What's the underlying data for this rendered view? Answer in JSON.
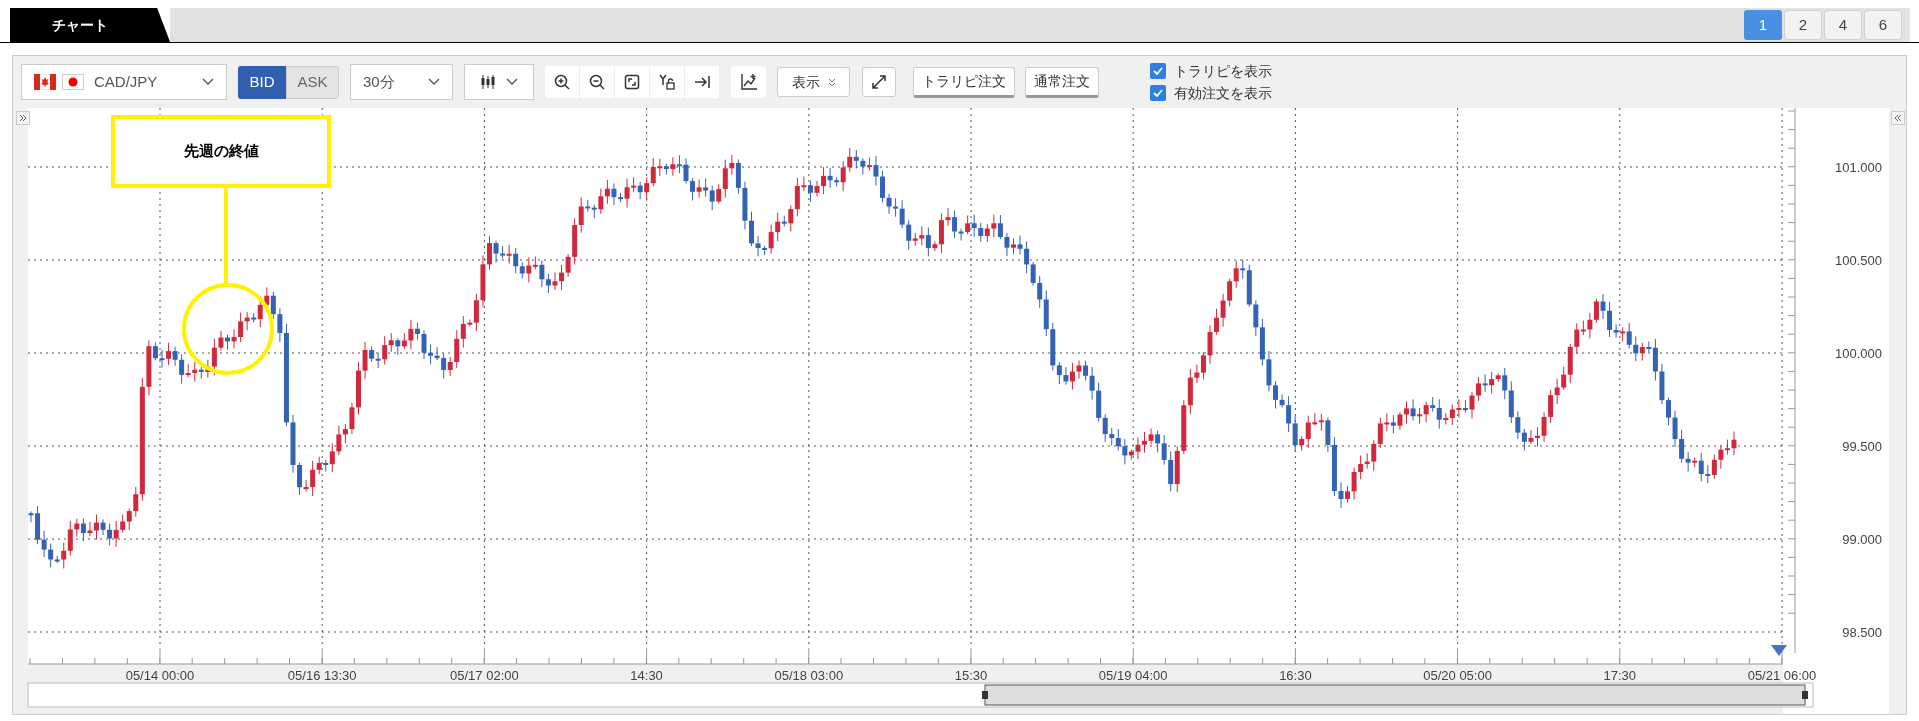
{
  "tabs": [
    {
      "label": "チャート",
      "selected": true
    }
  ],
  "layout_buttons": [
    {
      "label": "1",
      "selected": true
    },
    {
      "label": "2",
      "selected": false
    },
    {
      "label": "4",
      "selected": false
    },
    {
      "label": "6",
      "selected": false
    }
  ],
  "toolbar": {
    "pair": "CAD/JPY",
    "price_side": [
      {
        "label": "BID",
        "selected": true
      },
      {
        "label": "ASK",
        "selected": false
      }
    ],
    "timeframe": "30分",
    "display_menu": "表示",
    "order_buttons": [
      "トラリピ注文",
      "通常注文"
    ],
    "checkboxes": [
      {
        "label": "トラリピを表示",
        "checked": true
      },
      {
        "label": "有効注文を表示",
        "checked": true
      }
    ]
  },
  "annotation": "先週の終値",
  "y_axis": [
    "101.000",
    "100.500",
    "100.000",
    "99.500",
    "99.000",
    "98.500"
  ],
  "x_axis": [
    "05/14 00:00",
    "05/16 13:30",
    "05/17 02:00",
    "14:30",
    "05/18 03:00",
    "15:30",
    "05/19 04:00",
    "16:30",
    "05/20 05:00",
    "17:30",
    "05/21 06:00"
  ]
}
